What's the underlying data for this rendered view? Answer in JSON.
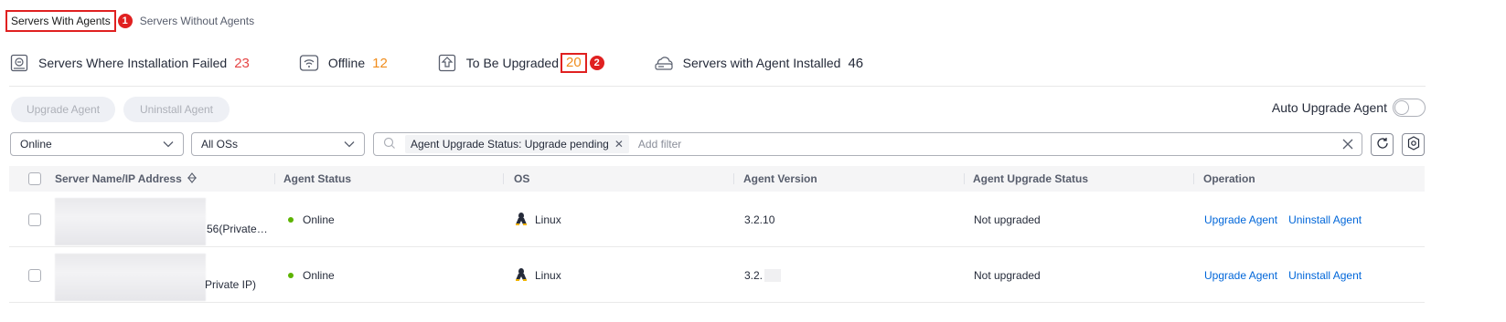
{
  "tabs": [
    {
      "label": "Servers With Agents",
      "marker": "1"
    },
    {
      "label": "Servers Without Agents"
    }
  ],
  "stats": [
    {
      "label": "Servers Where Installation Failed",
      "value": "23",
      "icon": "server-error-icon",
      "color": "#e54545"
    },
    {
      "label": "Offline",
      "value": "12",
      "icon": "wifi-offline-icon",
      "color": "#f08c1c"
    },
    {
      "label": "To Be Upgraded",
      "value": "20",
      "icon": "upgrade-arrow-icon",
      "color": "#f08c1c",
      "marker": "2"
    },
    {
      "label": "Servers with Agent Installed",
      "value": "46",
      "icon": "cloud-server-icon",
      "color": "#252b3a"
    }
  ],
  "toolbar": {
    "upgrade_label": "Upgrade Agent",
    "uninstall_label": "Uninstall Agent",
    "auto_upgrade_label": "Auto Upgrade Agent",
    "auto_upgrade_on": false
  },
  "filters": {
    "status_value": "Online",
    "os_value": "All OSs",
    "chip": "Agent Upgrade Status: Upgrade pending",
    "placeholder": "Add filter"
  },
  "table": {
    "columns": [
      "Server Name/IP Address",
      "Agent Status",
      "OS",
      "Agent Version",
      "Agent Upgrade Status",
      "Operation"
    ],
    "rows": [
      {
        "name_visible": "56(Private…",
        "status": "Online",
        "os": "Linux",
        "version": "3.2.10",
        "upgrade_status": "Not upgraded",
        "op1": "Upgrade Agent",
        "op2": "Uninstall Agent"
      },
      {
        "name_visible": "Private IP)",
        "status": "Online",
        "os": "Linux",
        "version": "3.2.",
        "upgrade_status": "Not upgraded",
        "op1": "Upgrade Agent",
        "op2": "Uninstall Agent"
      }
    ]
  },
  "colors": {
    "accent": "#0066d9",
    "online": "#5cb300",
    "annotation": "#e02020"
  }
}
